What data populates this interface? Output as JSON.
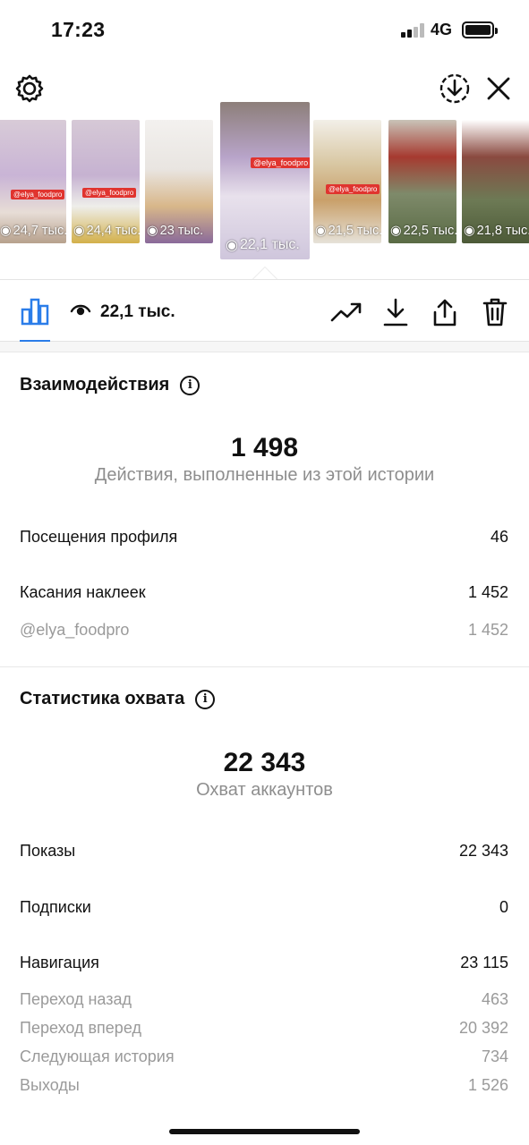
{
  "status_bar": {
    "time": "17:23",
    "network": "4G",
    "colors": {
      "text": "#111111"
    }
  },
  "top_actions": {
    "settings_icon": "gear-icon",
    "download_icon": "download-circle-icon",
    "close_icon": "close-icon"
  },
  "thumbnails": [
    {
      "views": "24,7 тыс.",
      "tag": "@elya_foodpro",
      "color": "#c9b4d6",
      "active": false
    },
    {
      "views": "24,4 тыс.",
      "tag": "@elya_foodpro",
      "color": "#c6b2d1",
      "active": false
    },
    {
      "views": "23 тыс.",
      "tag": "",
      "color": "#e9e5e1",
      "active": false
    },
    {
      "views": "22,1 тыс.",
      "tag": "@elya_foodpro",
      "color": "#b8a4c9",
      "active": true
    },
    {
      "views": "21,5 тыс.",
      "tag": "@elya_foodpro",
      "color": "#d9c8a4",
      "active": false
    },
    {
      "views": "22,5 тыс.",
      "tag": "",
      "color": "#7e8a6a",
      "active": false
    },
    {
      "views": "21,8 тыс.",
      "tag": "",
      "color": "#8a4a40",
      "active": false
    }
  ],
  "toolbar": {
    "views": "22,1 тыс.",
    "icons": [
      "bar-chart-icon",
      "eye-icon",
      "trending-up-icon",
      "download-icon",
      "share-icon",
      "trash-icon"
    ],
    "accent": "#2b7de9"
  },
  "interactions": {
    "title": "Взаимодействия",
    "total": "1 498",
    "subtitle": "Действия, выполненные из этой истории",
    "rows": [
      {
        "label": "Посещения профиля",
        "value": "46"
      },
      {
        "label": "Касания наклеек",
        "value": "1 452"
      },
      {
        "label": "@elya_foodpro",
        "value": "1 452",
        "muted": true
      }
    ]
  },
  "reach": {
    "title": "Статистика охвата",
    "total": "22 343",
    "subtitle": "Охват аккаунтов",
    "rows": [
      {
        "label": "Показы",
        "value": "22 343"
      },
      {
        "label": "Подписки",
        "value": "0"
      },
      {
        "label": "Навигация",
        "value": "23 115"
      },
      {
        "label": "Переход назад",
        "value": "463",
        "muted": true
      },
      {
        "label": "Переход вперед",
        "value": "20 392",
        "muted": true
      },
      {
        "label": "Следующая история",
        "value": "734",
        "muted": true
      },
      {
        "label": "Выходы",
        "value": "1 526",
        "muted": true
      }
    ]
  }
}
